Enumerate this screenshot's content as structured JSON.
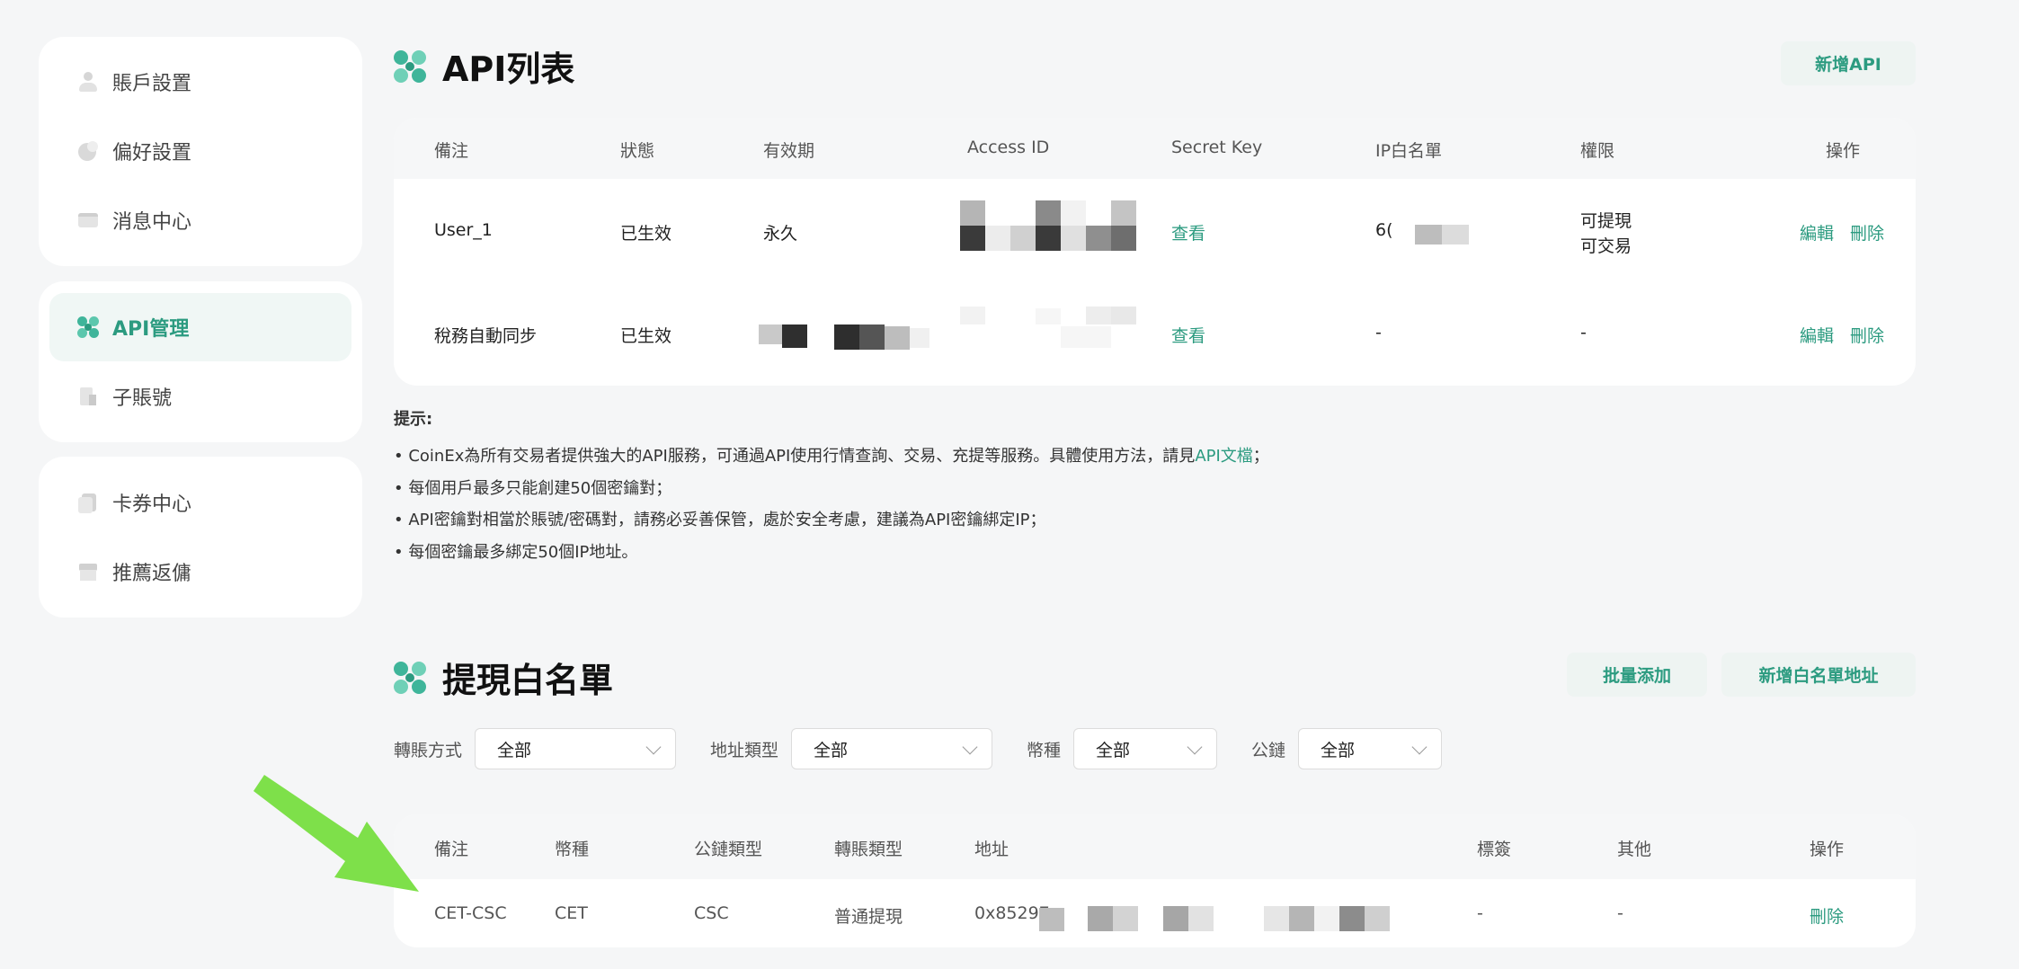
{
  "sidebar": {
    "group1": [
      {
        "label": "賬戶設置",
        "icon": "user-icon"
      },
      {
        "label": "偏好設置",
        "icon": "preferences-icon"
      },
      {
        "label": "消息中心",
        "icon": "message-icon"
      }
    ],
    "group2": [
      {
        "label": "API管理",
        "icon": "api-icon",
        "active": true
      },
      {
        "label": "子賬號",
        "icon": "subaccount-icon"
      }
    ],
    "group3": [
      {
        "label": "卡券中心",
        "icon": "coupon-icon"
      },
      {
        "label": "推薦返傭",
        "icon": "referral-icon"
      }
    ]
  },
  "api_section": {
    "title": "API列表",
    "add_button": "新增API",
    "columns": [
      "備注",
      "狀態",
      "有效期",
      "Access ID",
      "Secret Key",
      "IP白名單",
      "權限",
      "操作"
    ],
    "rows": [
      {
        "remark": "User_1",
        "status": "已生效",
        "validity": "永久",
        "secret": "查看",
        "ip": "6(",
        "perm1": "可提現",
        "perm2": "可交易",
        "edit": "編輯",
        "delete": "刪除"
      },
      {
        "remark": "稅務自動同步",
        "status": "已生效",
        "validity": "",
        "secret": "查看",
        "ip": "-",
        "perm1": "-",
        "perm2": "",
        "edit": "編輯",
        "delete": "刪除"
      }
    ]
  },
  "tips": {
    "title": "提示:",
    "line1_pre": "• CoinEx為所有交易者提供強大的API服務，可通過API使用行情查詢、交易、充提等服務。具體使用方法，請見",
    "line1_link": "API文檔",
    "line1_post": "；",
    "line2": "• 每個用戶最多只能創建50個密鑰對；",
    "line3": "• API密鑰對相當於賬號/密碼對，請務必妥善保管，處於安全考慮，建議為API密鑰綁定IP；",
    "line4": "• 每個密鑰最多綁定50個IP地址。"
  },
  "whitelist": {
    "title": "提現白名單",
    "batch_button": "批量添加",
    "add_button": "新增白名單地址",
    "filters": [
      {
        "label": "轉賬方式",
        "value": "全部"
      },
      {
        "label": "地址類型",
        "value": "全部"
      },
      {
        "label": "幣種",
        "value": "全部"
      },
      {
        "label": "公鏈",
        "value": "全部"
      }
    ],
    "columns": [
      "備注",
      "幣種",
      "公鏈類型",
      "轉賬類型",
      "地址",
      "標簽",
      "其他",
      "操作"
    ],
    "rows": [
      {
        "remark": "CET-CSC",
        "coin": "CET",
        "chain": "CSC",
        "type": "普通提現",
        "address": "0x85297",
        "tag": "-",
        "other": "-",
        "delete": "刪除"
      }
    ]
  },
  "colors": {
    "accent": "#2c9b80",
    "arrow": "#7ee04a"
  }
}
